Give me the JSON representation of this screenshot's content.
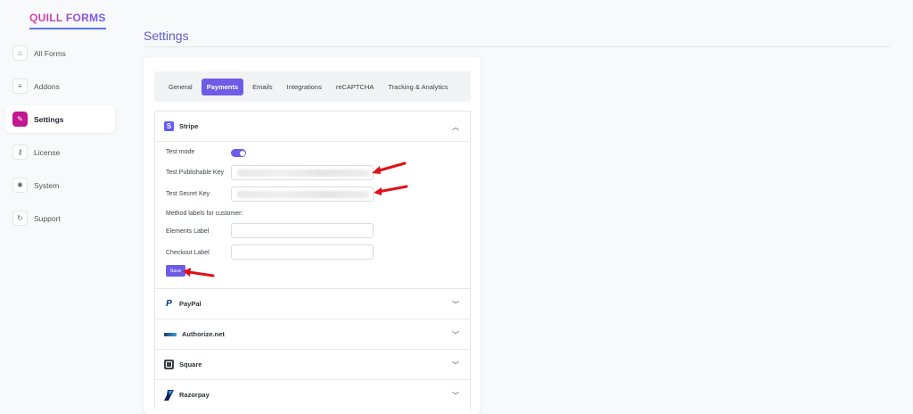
{
  "brand": {
    "logo_text": "QUILL FORMS"
  },
  "sidebar": {
    "items": [
      {
        "label": "All Forms",
        "icon": "home-icon",
        "active": false
      },
      {
        "label": "Addons",
        "icon": "addons-icon",
        "active": false
      },
      {
        "label": "Settings",
        "icon": "wrench-icon",
        "active": true
      },
      {
        "label": "License",
        "icon": "key-icon",
        "active": false
      },
      {
        "label": "System",
        "icon": "gear-icon",
        "active": false
      },
      {
        "label": "Support",
        "icon": "support-icon",
        "active": false
      }
    ]
  },
  "header": {
    "title": "Settings"
  },
  "tabs": [
    {
      "label": "General",
      "active": false
    },
    {
      "label": "Payments",
      "active": true
    },
    {
      "label": "Emails",
      "active": false
    },
    {
      "label": "Integrations",
      "active": false
    },
    {
      "label": "reCAPTCHA",
      "active": false
    },
    {
      "label": "Tracking & Analytics",
      "active": false
    }
  ],
  "stripe": {
    "name": "Stripe",
    "expanded": true,
    "test_mode_label": "Test mode",
    "test_mode_on": true,
    "publishable_key_label": "Test Publishable Key",
    "secret_key_label": "Test Secret Key",
    "method_labels_heading": "Method labels for customer:",
    "elements_label": "Elements Label",
    "elements_value": "",
    "checkout_label": "Checkout Label",
    "checkout_value": "",
    "save_label": "Save"
  },
  "gateways": [
    {
      "name": "PayPal",
      "icon": "paypal-logo"
    },
    {
      "name": "Authorize.net",
      "icon": "authorize-net-logo"
    },
    {
      "name": "Square",
      "icon": "square-logo"
    },
    {
      "name": "Razorpay",
      "icon": "razorpay-logo"
    }
  ],
  "colors": {
    "accent": "#6c5ce7",
    "active_menu_icon": "#c2188f",
    "annotation_arrow": "#e0101a"
  }
}
